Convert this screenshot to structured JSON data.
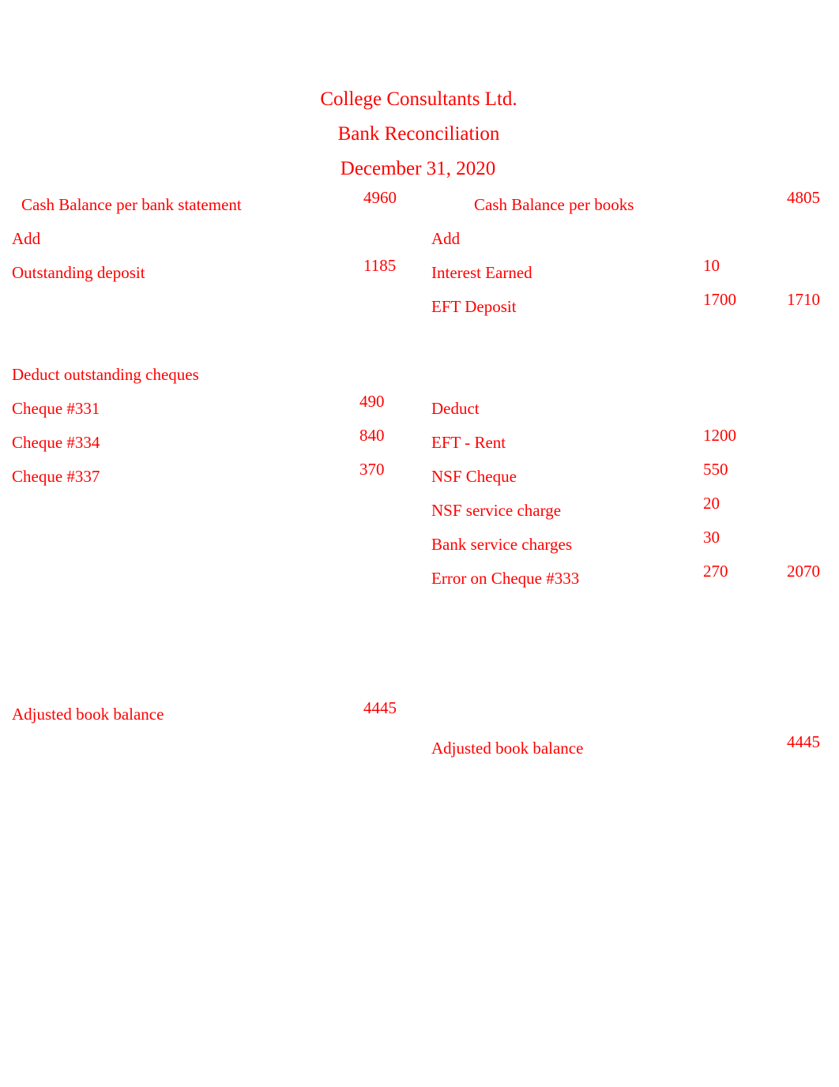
{
  "document": {
    "title_lines": [
      "College Consultants Ltd.",
      "Bank Reconciliation",
      "December 31, 2020"
    ],
    "text_color": "#ff0000",
    "background_color": "#ffffff"
  },
  "bank_side": {
    "opening": {
      "label": "Cash Balance per bank statement",
      "amount": "4960"
    },
    "add_heading": "Add",
    "add_items": [
      {
        "label": "Outstanding deposit",
        "amount": "1185"
      }
    ],
    "deduct_heading": "Deduct outstanding cheques",
    "deduct_items": [
      {
        "label": "Cheque #331",
        "amount": "490"
      },
      {
        "label": "Cheque #334",
        "amount": "840"
      },
      {
        "label": "Cheque #337",
        "amount": "370"
      }
    ],
    "total": {
      "label": "Adjusted book balance",
      "amount": "4445"
    }
  },
  "books_side": {
    "opening": {
      "label": "Cash Balance per books",
      "amount": "4805"
    },
    "add_heading": "Add",
    "add_items": [
      {
        "label": "Interest Earned",
        "amount": "10",
        "subtotal": ""
      },
      {
        "label": "EFT Deposit",
        "amount": "1700",
        "subtotal": "1710"
      }
    ],
    "deduct_heading": "Deduct",
    "deduct_items": [
      {
        "label": "EFT - Rent",
        "amount": "1200",
        "subtotal": ""
      },
      {
        "label": "NSF Cheque",
        "amount": "550",
        "subtotal": ""
      },
      {
        "label": "NSF service charge",
        "amount": "20",
        "subtotal": ""
      },
      {
        "label": "Bank service charges",
        "amount": "30",
        "subtotal": ""
      },
      {
        "label": "Error on Cheque #333",
        "amount": "270",
        "subtotal": "2070"
      }
    ],
    "total": {
      "label": "Adjusted book balance",
      "amount": "4445"
    }
  }
}
